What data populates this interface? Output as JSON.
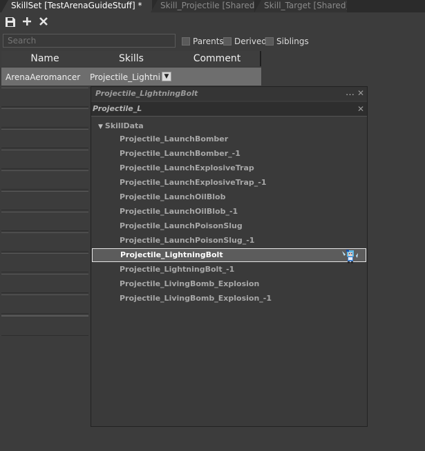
{
  "tabs": [
    {
      "label": "SkillSet [TestArenaGuideStuff] *"
    },
    {
      "label": "Skill_Projectile [Shared]"
    },
    {
      "label": "Skill_Target [Shared]"
    }
  ],
  "toolbar": {
    "save_icon": "save-icon",
    "add_icon": "plus-icon",
    "delete_icon": "x-icon"
  },
  "search": {
    "placeholder": "Search"
  },
  "filters": [
    {
      "label": "Parents",
      "checked": false
    },
    {
      "label": "Derived",
      "checked": false
    },
    {
      "label": "Siblings",
      "checked": false
    }
  ],
  "grid": {
    "headers": [
      "Name",
      "Skills",
      "Comment"
    ],
    "rows": [
      {
        "name": "ArenaAeromancer",
        "skills": "Projectile_LightningBolt",
        "comment": ""
      }
    ]
  },
  "popup": {
    "title": "Projectile_LightningBolt",
    "search_value": "Projectile_L",
    "tree_root": "SkillData",
    "items": [
      "Projectile_LaunchBomber",
      "Projectile_LaunchBomber_-1",
      "Projectile_LaunchExplosiveTrap",
      "Projectile_LaunchExplosiveTrap_-1",
      "Projectile_LaunchOilBlob",
      "Projectile_LaunchOilBlob_-1",
      "Projectile_LaunchPoisonSlug",
      "Projectile_LaunchPoisonSlug_-1",
      "Projectile_LightningBolt",
      "Projectile_LightningBolt_-1",
      "Projectile_LivingBomb_Explosion",
      "Projectile_LivingBomb_Explosion_-1"
    ],
    "selected": "Projectile_LightningBolt"
  },
  "colors": {
    "background": "#3c3c3c",
    "selected_row": "#6e6e6e",
    "text": "#dcdcdc"
  }
}
